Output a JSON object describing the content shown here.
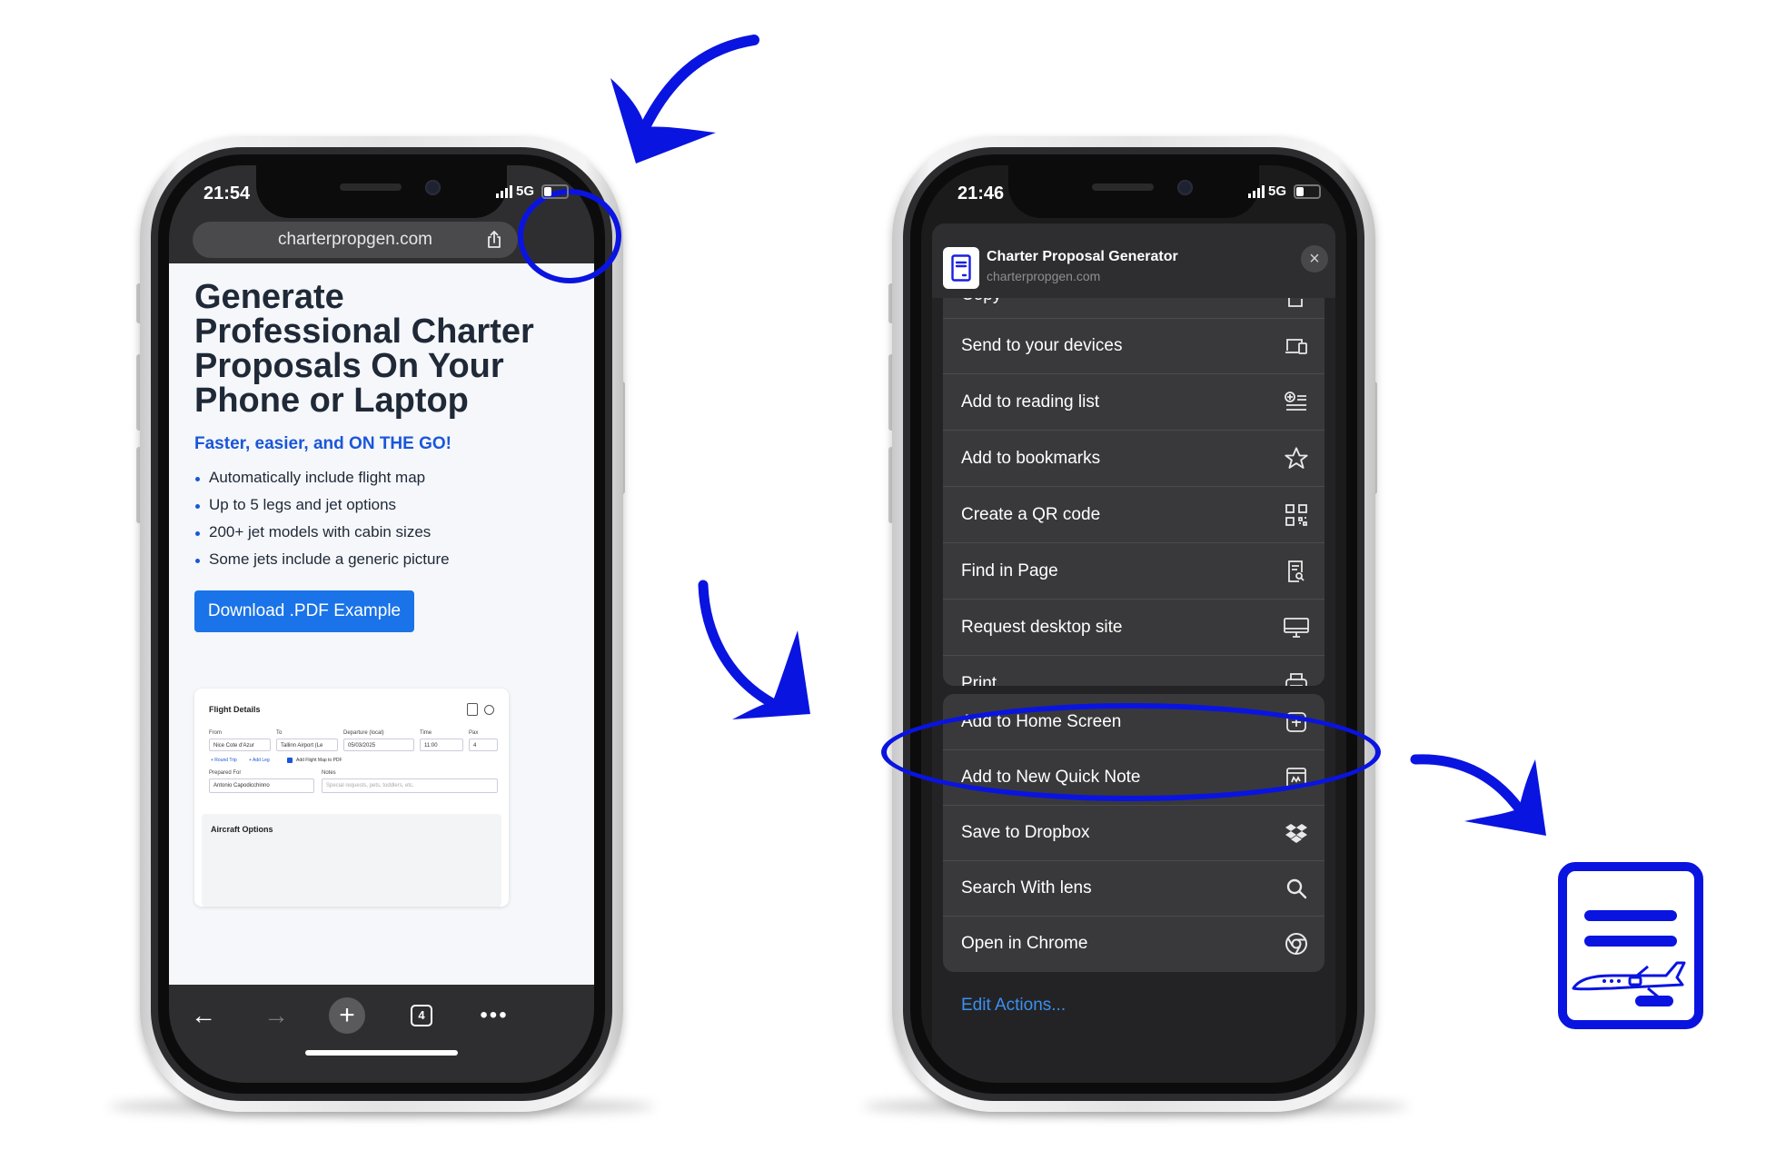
{
  "left_phone": {
    "status_time": "21:54",
    "network": "5G",
    "url": "charterpropgen.com",
    "hero_title": "Generate Professional Charter Proposals On Your Phone or Laptop",
    "hero_subtitle": "Faster, easier, and ON THE GO!",
    "features": [
      "Automatically include flight map",
      "Up to 5 legs and jet options",
      "200+ jet models with cabin sizes",
      "Some jets include a generic picture"
    ],
    "download_button": "Download .PDF Example",
    "preview": {
      "title": "Flight Details",
      "labels": {
        "from": "From",
        "to": "To",
        "departure": "Departure (local)",
        "time": "Time",
        "pax": "Pax",
        "prepared_for": "Prepared For",
        "notes": "Notes"
      },
      "values": {
        "from": "Nice Cote d'Azur",
        "to": "Tallinn Airport (Le",
        "departure": "05/03/2025",
        "time": "11:00",
        "pax": "4",
        "prepared_for": "Antonio Capodicchinno",
        "notes_placeholder": "Special requests, pets, toddlers, etc."
      },
      "links": {
        "round_trip": "+ Round Trip",
        "add_leg": "+ Add Leg",
        "add_map": "Add Flight Map to PDF"
      },
      "aircraft_options": "Aircraft Options"
    },
    "tab_count": "4"
  },
  "right_phone": {
    "status_time": "21:46",
    "network": "5G",
    "sheet_title": "Charter Proposal Generator",
    "sheet_url": "charterpropgen.com",
    "partial_row": "Copy",
    "actions_group1": [
      {
        "label": "Send to your devices",
        "icon": "devices-icon"
      },
      {
        "label": "Add to reading list",
        "icon": "reading-list-icon"
      },
      {
        "label": "Add to bookmarks",
        "icon": "star-icon"
      },
      {
        "label": "Create a QR code",
        "icon": "qr-code-icon"
      },
      {
        "label": "Find in Page",
        "icon": "find-in-page-icon"
      },
      {
        "label": "Request desktop site",
        "icon": "desktop-icon"
      },
      {
        "label": "Print",
        "icon": "print-icon"
      }
    ],
    "actions_group2": [
      {
        "label": "Add to Home Screen",
        "icon": "add-square-icon"
      },
      {
        "label": "Add to New Quick Note",
        "icon": "quick-note-icon"
      },
      {
        "label": "Save to Dropbox",
        "icon": "dropbox-icon"
      },
      {
        "label": "Search With lens",
        "icon": "search-icon"
      },
      {
        "label": "Open in Chrome",
        "icon": "chrome-icon"
      }
    ],
    "edit_actions": "Edit Actions..."
  },
  "colors": {
    "annotation_blue": "#0a14e0",
    "brand_blue": "#1a73e8",
    "link_blue": "#3b8ff0"
  }
}
